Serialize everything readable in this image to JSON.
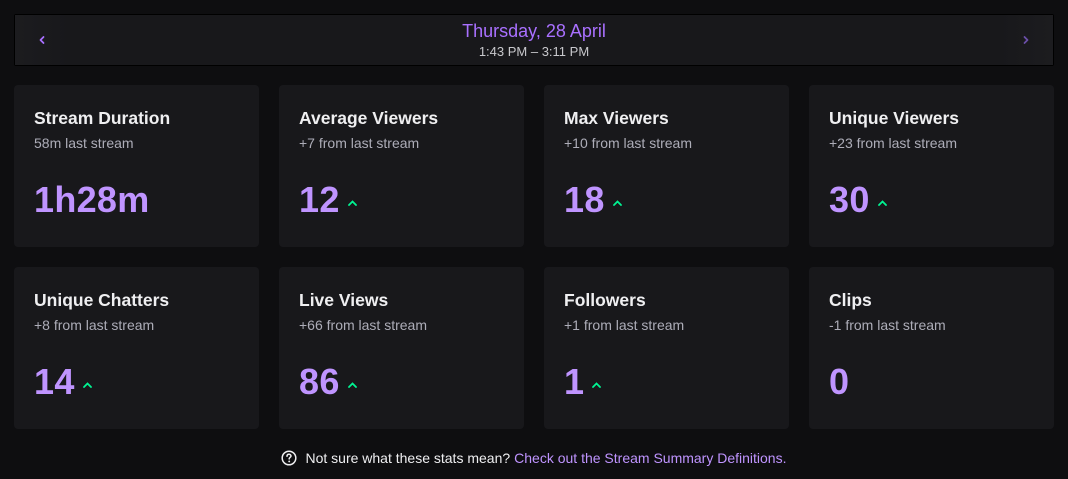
{
  "header": {
    "date": "Thursday, 28 April",
    "time_range": "1:43 PM – 3:11 PM",
    "prev_icon": "chevron-left-icon",
    "next_icon": "chevron-right-icon"
  },
  "colors": {
    "accent": "#a970ff",
    "value": "#bf94ff",
    "trend_up": "#00f593",
    "card_bg": "#18181b",
    "page_bg": "#0e0e10"
  },
  "stats": [
    {
      "title": "Stream Duration",
      "subtitle": "58m last stream",
      "value": "1h28m",
      "trend": "none"
    },
    {
      "title": "Average Viewers",
      "subtitle": "+7 from last stream",
      "value": "12",
      "trend": "up"
    },
    {
      "title": "Max Viewers",
      "subtitle": "+10 from last stream",
      "value": "18",
      "trend": "up"
    },
    {
      "title": "Unique Viewers",
      "subtitle": "+23 from last stream",
      "value": "30",
      "trend": "up"
    },
    {
      "title": "Unique Chatters",
      "subtitle": "+8 from last stream",
      "value": "14",
      "trend": "up"
    },
    {
      "title": "Live Views",
      "subtitle": "+66 from last stream",
      "value": "86",
      "trend": "up"
    },
    {
      "title": "Followers",
      "subtitle": "+1 from last stream",
      "value": "1",
      "trend": "up"
    },
    {
      "title": "Clips",
      "subtitle": "-1 from last stream",
      "value": "0",
      "trend": "none"
    }
  ],
  "footer": {
    "question": "Not sure what these stats mean?",
    "link": "Check out the Stream Summary Definitions.",
    "icon": "help-circle-icon"
  }
}
